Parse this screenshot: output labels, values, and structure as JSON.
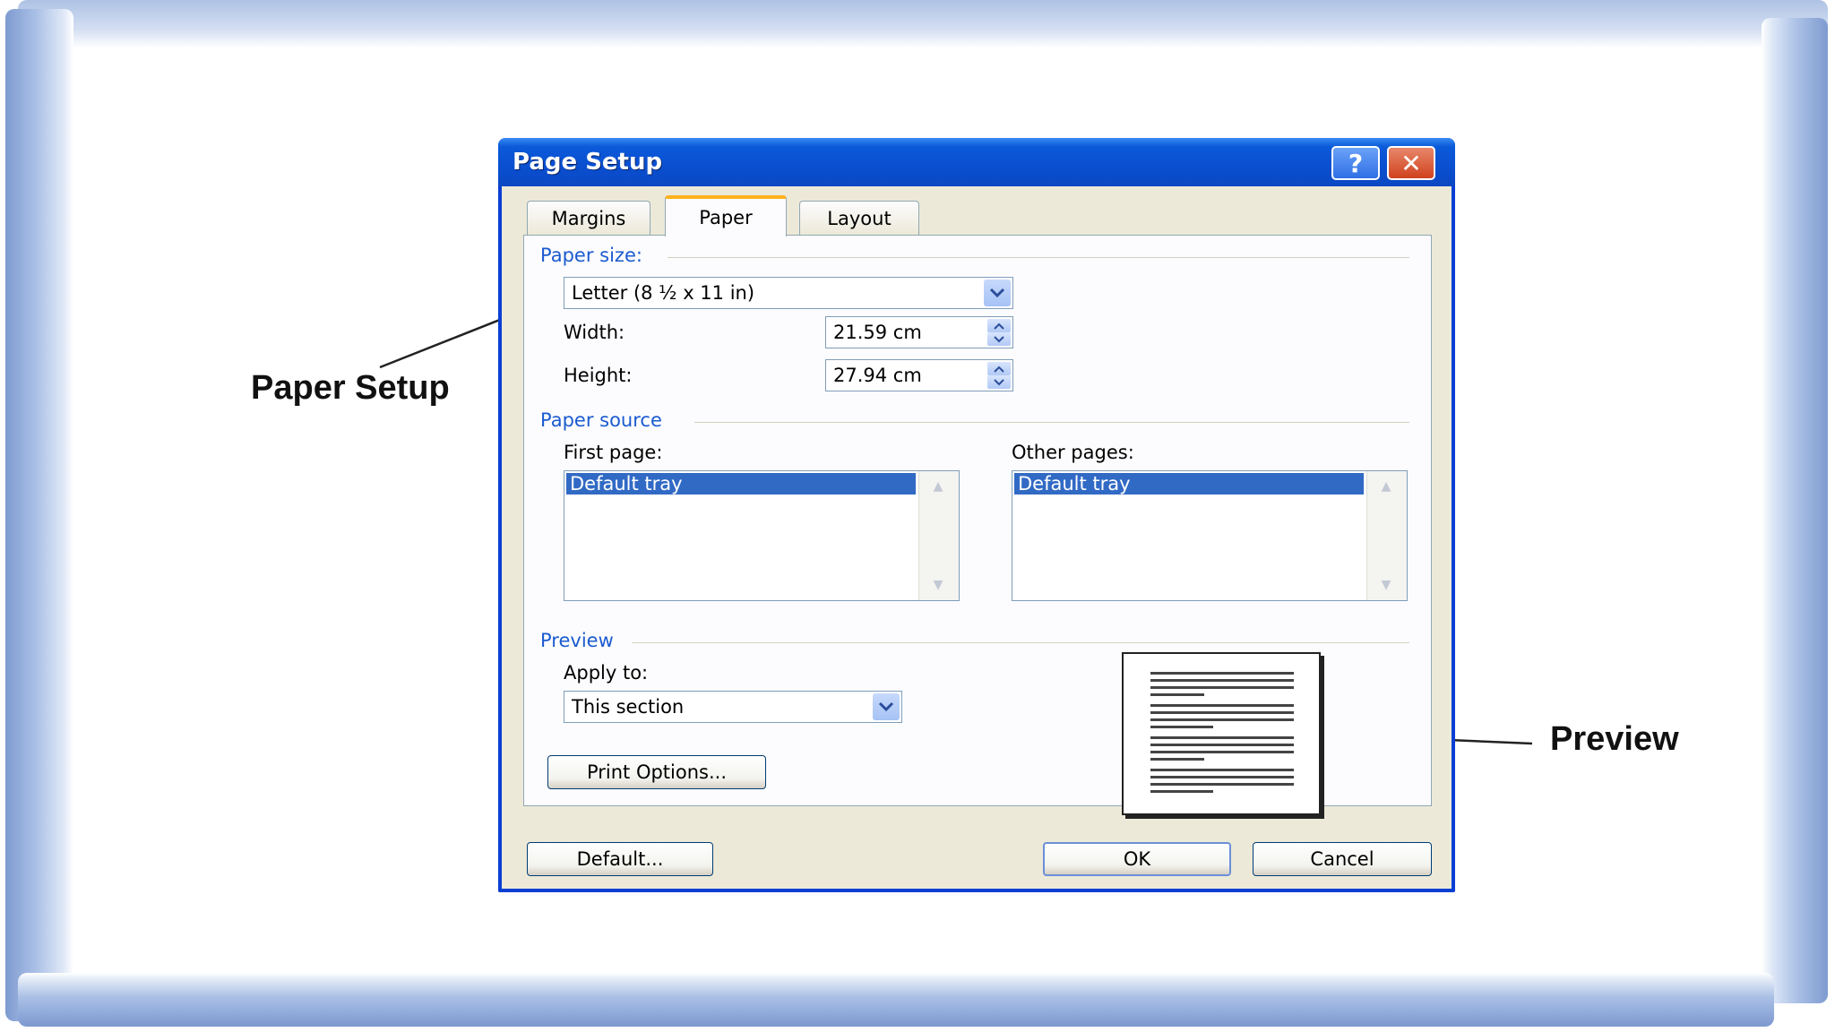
{
  "annotations": {
    "paper_setup": "Paper Setup",
    "preview": "Preview"
  },
  "dialog": {
    "title": "Page Setup",
    "help_glyph": "?",
    "close_glyph": "✕",
    "tabs": [
      {
        "label": "Margins",
        "selected": false
      },
      {
        "label": "Paper",
        "selected": true
      },
      {
        "label": "Layout",
        "selected": false
      }
    ],
    "paper_size": {
      "group_label": "Paper size:",
      "selected": "Letter (8 ½ x 11 in)",
      "width_label": "Width:",
      "width_value": "21.59 cm",
      "height_label": "Height:",
      "height_value": "27.94 cm"
    },
    "paper_source": {
      "group_label": "Paper source",
      "first_page_label": "First page:",
      "first_page_item": "Default tray",
      "other_pages_label": "Other pages:",
      "other_pages_item": "Default tray"
    },
    "preview": {
      "group_label": "Preview",
      "apply_to_label": "Apply to:",
      "apply_to_value": "This section"
    },
    "buttons": {
      "print_options": "Print Options...",
      "default": "Default...",
      "ok": "OK",
      "cancel": "Cancel"
    }
  },
  "colors": {
    "titlebar": "#0b4fd0",
    "group_label": "#1b5bcf",
    "selection": "#316ac5",
    "dialog_bg": "#ece9d8"
  }
}
